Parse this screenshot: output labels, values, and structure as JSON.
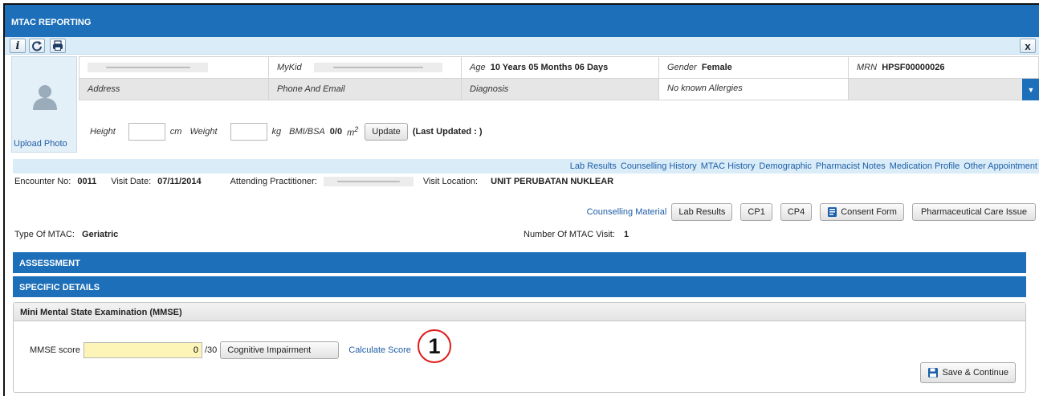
{
  "window": {
    "title": "MTAC REPORTING"
  },
  "toolbar": {
    "info_icon": "info-icon",
    "refresh_icon": "refresh-icon",
    "print_icon": "print-icon",
    "close_label": "x"
  },
  "patient": {
    "mykid_label": "MyKid",
    "age_label": "Age",
    "age_value": "10 Years 05 Months 06 Days",
    "gender_label": "Gender",
    "gender_value": "Female",
    "mrn_label": "MRN",
    "mrn_value": "HPSF00000026",
    "address_label": "Address",
    "phone_label": "Phone And Email",
    "diagnosis_label": "Diagnosis",
    "allergies_text": "No known Allergies",
    "height_label": "Height",
    "height_unit": "cm",
    "weight_label": "Weight",
    "weight_unit": "kg",
    "bmi_label": "BMI/BSA",
    "bmi_value": "0/0",
    "bmi_unit": "m",
    "bmi_unit_sup": "2",
    "update_button": "Update",
    "last_updated": "(Last Updated : )",
    "upload_photo": "Upload Photo"
  },
  "links": [
    "Lab Results",
    "Counselling History",
    "MTAC History",
    "Demographic",
    "Pharmacist Notes",
    "Medication Profile",
    "Other Appointment"
  ],
  "encounter": {
    "no_label": "Encounter No:",
    "no_value": "0011",
    "visit_date_label": "Visit Date:",
    "visit_date_value": "07/11/2014",
    "practitioner_label": "Attending Practitioner:",
    "location_label": "Visit Location:",
    "location_value": "UNIT PERUBATAN NUKLEAR"
  },
  "actions": {
    "counselling_material": "Counselling Material",
    "lab_results": "Lab Results",
    "cp1": "CP1",
    "cp4": "CP4",
    "consent_form": "Consent Form",
    "pharma_issue": "Pharmaceutical Care Issue"
  },
  "mtac": {
    "type_label": "Type Of MTAC:",
    "type_value": "Geriatric",
    "visit_label": "Number Of MTAC Visit:",
    "visit_value": "1"
  },
  "sections": {
    "assessment": "ASSESSMENT",
    "specific_details": "SPECIFIC DETAILS"
  },
  "mmse": {
    "panel_title": "Mini Mental State Examination (MMSE)",
    "score_label": "MMSE score",
    "score_value": "0",
    "score_max": "/30",
    "impairment_button": "Cognitive Impairment",
    "calculate_link": "Calculate Score",
    "save_button": "Save & Continue"
  },
  "annotation": {
    "callout_number": "1"
  },
  "colors": {
    "header_blue": "#1c6fb8",
    "light_blue": "#d9ecf8",
    "link_blue": "#1f5ea8",
    "callout_red": "#e01b1b",
    "input_yellow": "#fdf5b8"
  }
}
